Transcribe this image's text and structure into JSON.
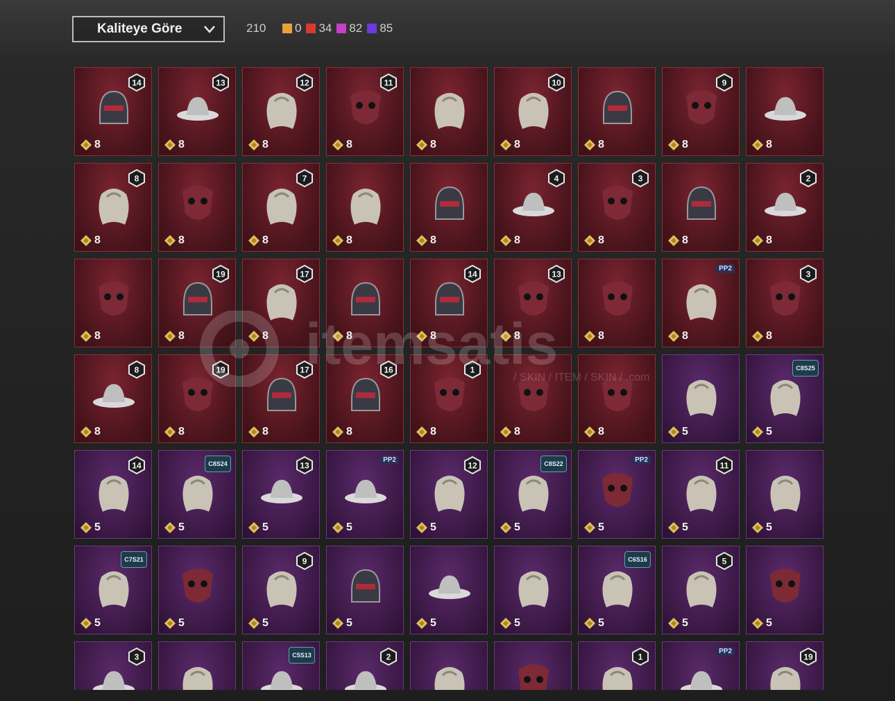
{
  "sort_dropdown": {
    "label": "Kaliteye Göre"
  },
  "total_count": "210",
  "quality_counts": [
    {
      "value": "0",
      "color": "#e8a23a"
    },
    {
      "value": "34",
      "color": "#d83a30"
    },
    {
      "value": "82",
      "color": "#c440c8"
    },
    {
      "value": "85",
      "color": "#6c3ae0"
    }
  ],
  "watermark": {
    "brand": "itemsatis",
    "sub": "/ SKIN / ITEM / SKIN / .com"
  },
  "rows": [
    [
      {
        "tier": "red",
        "price": "8",
        "badge": "14",
        "icon": "helmet-icon"
      },
      {
        "tier": "red",
        "price": "8",
        "badge": "13",
        "icon": "hat-icon"
      },
      {
        "tier": "red",
        "price": "8",
        "badge": "12",
        "icon": "hair-icon"
      },
      {
        "tier": "red",
        "price": "8",
        "badge": "11",
        "icon": "mask-icon"
      },
      {
        "tier": "red",
        "price": "8",
        "badge": "",
        "icon": "hair-icon"
      },
      {
        "tier": "red",
        "price": "8",
        "badge": "10",
        "icon": "hair-icon"
      },
      {
        "tier": "red",
        "price": "8",
        "badge": "",
        "icon": "helmet-icon"
      },
      {
        "tier": "red",
        "price": "8",
        "badge": "9",
        "icon": "mask-icon"
      },
      {
        "tier": "red",
        "price": "8",
        "badge": "",
        "icon": "hat-icon"
      }
    ],
    [
      {
        "tier": "red",
        "price": "8",
        "badge": "8",
        "icon": "hair-icon"
      },
      {
        "tier": "red",
        "price": "8",
        "badge": "",
        "icon": "mask-icon"
      },
      {
        "tier": "red",
        "price": "8",
        "badge": "7",
        "icon": "hair-icon"
      },
      {
        "tier": "red",
        "price": "8",
        "badge": "",
        "icon": "hair-icon"
      },
      {
        "tier": "red",
        "price": "8",
        "badge": "",
        "icon": "helmet-icon"
      },
      {
        "tier": "red",
        "price": "8",
        "badge": "4",
        "icon": "hat-icon"
      },
      {
        "tier": "red",
        "price": "8",
        "badge": "3",
        "icon": "mask-icon"
      },
      {
        "tier": "red",
        "price": "8",
        "badge": "",
        "icon": "helmet-icon"
      },
      {
        "tier": "red",
        "price": "8",
        "badge": "2",
        "icon": "hat-icon"
      }
    ],
    [
      {
        "tier": "red",
        "price": "8",
        "badge": "",
        "icon": "mask-icon"
      },
      {
        "tier": "red",
        "price": "8",
        "badge": "19",
        "icon": "helmet-icon"
      },
      {
        "tier": "red",
        "price": "8",
        "badge": "17",
        "icon": "hair-icon"
      },
      {
        "tier": "red",
        "price": "8",
        "badge": "",
        "icon": "helmet-icon"
      },
      {
        "tier": "red",
        "price": "8",
        "badge": "14",
        "icon": "helmet-icon"
      },
      {
        "tier": "red",
        "price": "8",
        "badge": "13",
        "icon": "mask-icon"
      },
      {
        "tier": "red",
        "price": "8",
        "badge": "",
        "icon": "mask-icon"
      },
      {
        "tier": "red",
        "price": "8",
        "badge": "",
        "pp": "PP2",
        "icon": "hair-icon"
      },
      {
        "tier": "red",
        "price": "8",
        "badge": "3",
        "icon": "mask-icon"
      }
    ],
    [
      {
        "tier": "red",
        "price": "8",
        "badge": "8",
        "icon": "hat-icon"
      },
      {
        "tier": "red",
        "price": "8",
        "badge": "19",
        "icon": "mask-icon"
      },
      {
        "tier": "red",
        "price": "8",
        "badge": "17",
        "icon": "helmet-icon"
      },
      {
        "tier": "red",
        "price": "8",
        "badge": "16",
        "icon": "helmet-icon"
      },
      {
        "tier": "red",
        "price": "8",
        "badge": "1",
        "icon": "mask-icon"
      },
      {
        "tier": "red",
        "price": "8",
        "badge": "",
        "icon": "mask-icon"
      },
      {
        "tier": "red",
        "price": "8",
        "badge": "",
        "icon": "mask-icon"
      },
      {
        "tier": "purple",
        "price": "5",
        "badge": "",
        "icon": "hair-icon"
      },
      {
        "tier": "purple",
        "price": "5",
        "badge": "",
        "season": "C8S25",
        "icon": "hair-icon"
      }
    ],
    [
      {
        "tier": "purple",
        "price": "5",
        "badge": "14",
        "icon": "hair-icon"
      },
      {
        "tier": "purple",
        "price": "5",
        "badge": "",
        "season": "C8S24",
        "icon": "hair-icon"
      },
      {
        "tier": "purple",
        "price": "5",
        "badge": "13",
        "icon": "hat-icon"
      },
      {
        "tier": "purple",
        "price": "5",
        "badge": "",
        "pp": "PP2",
        "icon": "hat-icon"
      },
      {
        "tier": "purple",
        "price": "5",
        "badge": "12",
        "icon": "hair-icon"
      },
      {
        "tier": "purple",
        "price": "5",
        "badge": "",
        "season": "C8S22",
        "icon": "hair-icon"
      },
      {
        "tier": "purple",
        "price": "5",
        "badge": "",
        "pp": "PP2",
        "icon": "mask-icon"
      },
      {
        "tier": "purple",
        "price": "5",
        "badge": "11",
        "icon": "hair-icon"
      },
      {
        "tier": "purple",
        "price": "5",
        "badge": "",
        "icon": "hair-icon"
      }
    ],
    [
      {
        "tier": "purple",
        "price": "5",
        "badge": "",
        "season": "C7S21",
        "icon": "hair-icon"
      },
      {
        "tier": "purple",
        "price": "5",
        "badge": "",
        "icon": "mask-icon"
      },
      {
        "tier": "purple",
        "price": "5",
        "badge": "9",
        "icon": "hair-icon"
      },
      {
        "tier": "purple",
        "price": "5",
        "badge": "",
        "icon": "helmet-icon"
      },
      {
        "tier": "purple",
        "price": "5",
        "badge": "",
        "icon": "hat-icon"
      },
      {
        "tier": "purple",
        "price": "5",
        "badge": "",
        "icon": "hair-icon"
      },
      {
        "tier": "purple",
        "price": "5",
        "badge": "",
        "season": "C6S16",
        "icon": "hair-icon"
      },
      {
        "tier": "purple",
        "price": "5",
        "badge": "5",
        "icon": "hair-icon"
      },
      {
        "tier": "purple",
        "price": "5",
        "badge": "",
        "icon": "mask-icon"
      }
    ],
    [
      {
        "tier": "purple",
        "price": "",
        "badge": "3",
        "icon": "hat-icon"
      },
      {
        "tier": "purple",
        "price": "",
        "badge": "",
        "icon": "hair-icon"
      },
      {
        "tier": "purple",
        "price": "",
        "badge": "",
        "season": "C5S13",
        "icon": "hat-icon"
      },
      {
        "tier": "purple",
        "price": "",
        "badge": "2",
        "icon": "hat-icon"
      },
      {
        "tier": "purple",
        "price": "",
        "badge": "",
        "icon": "hair-icon"
      },
      {
        "tier": "purple",
        "price": "",
        "badge": "",
        "icon": "mask-icon"
      },
      {
        "tier": "purple",
        "price": "",
        "badge": "1",
        "icon": "hair-icon"
      },
      {
        "tier": "purple",
        "price": "",
        "badge": "",
        "pp": "PP2",
        "icon": "hat-icon"
      },
      {
        "tier": "purple",
        "price": "",
        "badge": "19",
        "icon": "hair-icon"
      }
    ]
  ]
}
